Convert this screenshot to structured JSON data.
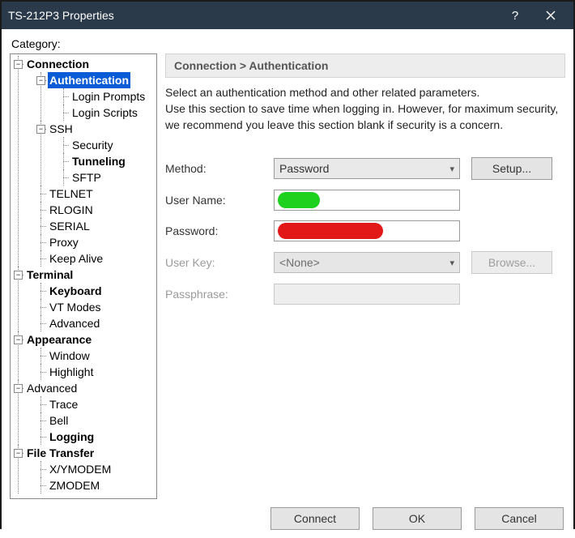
{
  "window": {
    "title": "TS-212P3 Properties"
  },
  "category_label": "Category:",
  "tree": {
    "connection": "Connection",
    "authentication": "Authentication",
    "login_prompts": "Login Prompts",
    "login_scripts": "Login Scripts",
    "ssh": "SSH",
    "security": "Security",
    "tunneling": "Tunneling",
    "sftp": "SFTP",
    "telnet": "TELNET",
    "rlogin": "RLOGIN",
    "serial": "SERIAL",
    "proxy": "Proxy",
    "keep_alive": "Keep Alive",
    "terminal": "Terminal",
    "keyboard": "Keyboard",
    "vt_modes": "VT Modes",
    "advanced_t": "Advanced",
    "appearance": "Appearance",
    "window_": "Window",
    "highlight": "Highlight",
    "advanced": "Advanced",
    "trace": "Trace",
    "bell": "Bell",
    "logging": "Logging",
    "file_transfer": "File Transfer",
    "xymodem": "X/YMODEM",
    "zmodem": "ZMODEM"
  },
  "breadcrumb": "Connection > Authentication",
  "description_line1": "Select an authentication method and other related parameters.",
  "description_line2": "Use this section to save time when logging in. However, for maximum security, we recommend you leave this section blank if security is a concern.",
  "form": {
    "method_label": "Method:",
    "method_value": "Password",
    "setup_btn": "Setup...",
    "username_label": "User Name:",
    "password_label": "Password:",
    "userkey_label": "User Key:",
    "userkey_value": "<None>",
    "browse_btn": "Browse...",
    "passphrase_label": "Passphrase:"
  },
  "footer": {
    "connect": "Connect",
    "ok": "OK",
    "cancel": "Cancel"
  },
  "icons": {
    "help": "?",
    "minus": "−"
  }
}
